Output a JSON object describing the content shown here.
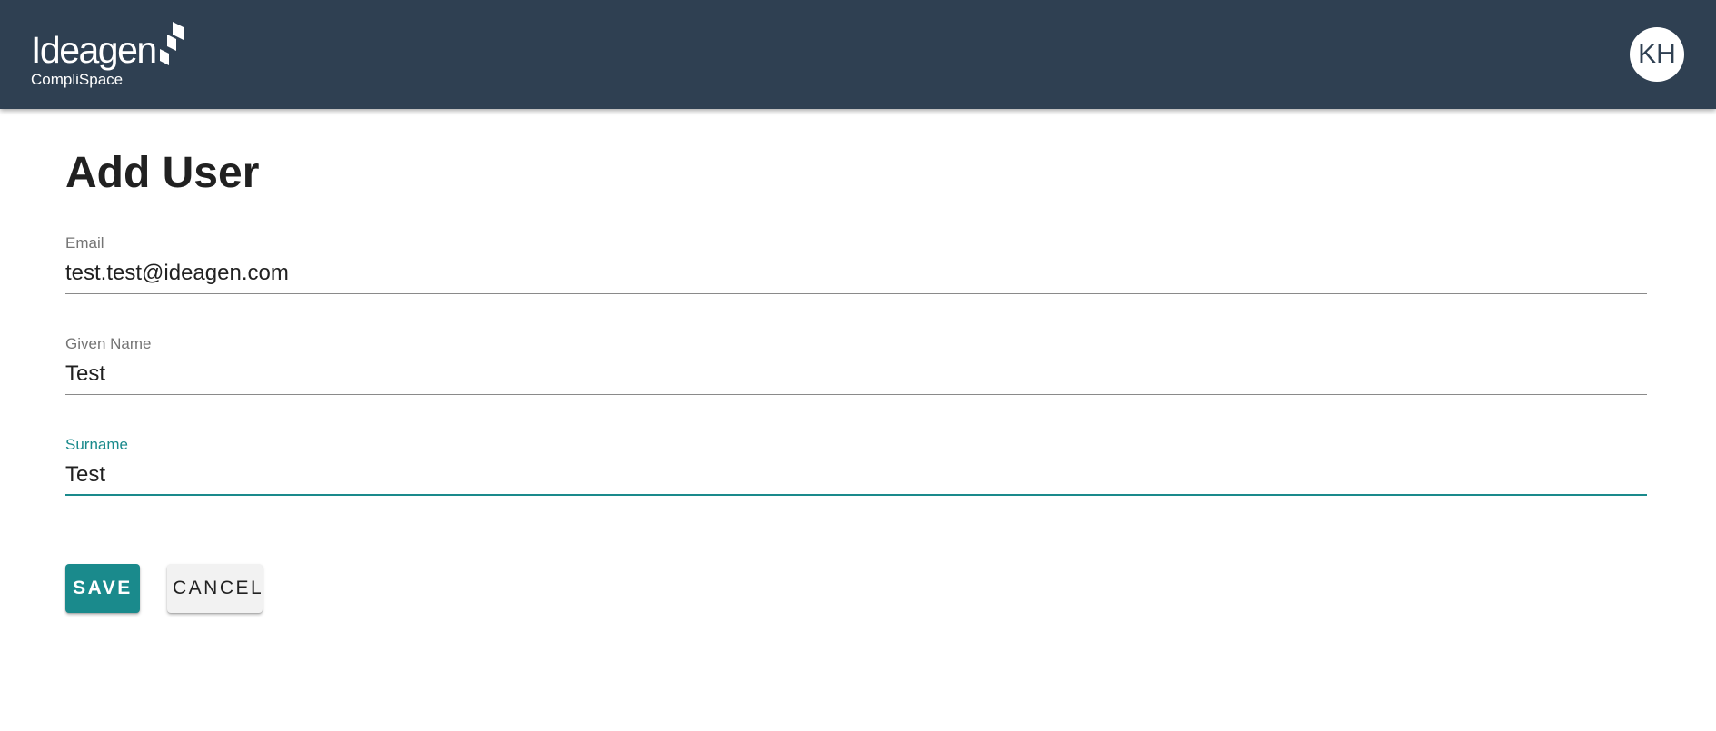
{
  "header": {
    "brand": "Ideagen",
    "product": "CompliSpace",
    "user_initials": "KH",
    "background_color": "#2f4052"
  },
  "page": {
    "title": "Add User"
  },
  "form": {
    "email": {
      "label": "Email",
      "value": "test.test@ideagen.com"
    },
    "given_name": {
      "label": "Given Name",
      "value": "Test"
    },
    "surname": {
      "label": "Surname",
      "value": "Test",
      "focused": true
    }
  },
  "actions": {
    "save_label": "SAVE",
    "cancel_label": "CANCEL"
  },
  "colors": {
    "accent": "#1a8a8c",
    "header": "#2f4052"
  }
}
